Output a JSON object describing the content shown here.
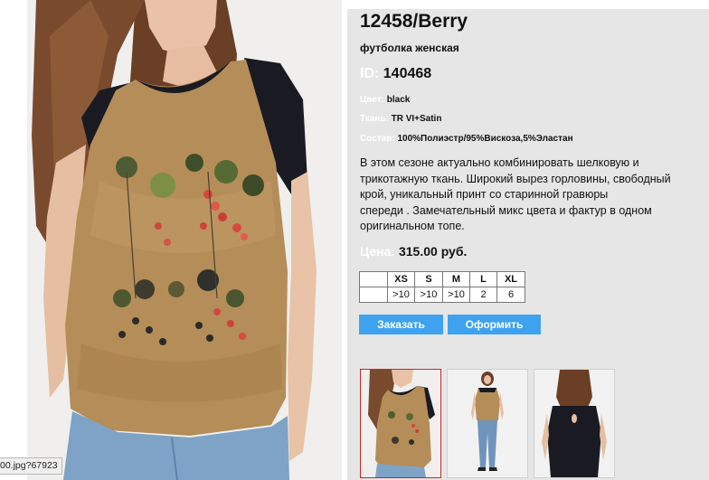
{
  "product": {
    "title": "12458/Berry",
    "subtitle": "футболка женская",
    "id_label": "ID:",
    "id_value": "140468",
    "color_label": "Цвет:",
    "color_value": "black",
    "fabric_label": "Ткань:",
    "fabric_value": "TR VI+Satin",
    "composition_label": "Состав:",
    "composition_value": "100%Полиэстр/95%Вискоза,5%Эластан",
    "description_lines": [
      "В этом сезоне актуально комбинировать шелковую и",
      "трикотажную ткань. Широкий вырез горловины, свободный",
      "крой, уникальный принт со старинной гравюры",
      "спереди .  Замечательный микс цвета и фактур в одном",
      "оригинальном топе."
    ],
    "price_label": "Цена:",
    "price_value": "315.00 руб."
  },
  "sizes": {
    "headers": [
      "",
      "XS",
      "S",
      "M",
      "L",
      "XL"
    ],
    "stock": [
      "",
      ">10",
      ">10",
      ">10",
      "2",
      "6"
    ]
  },
  "buttons": {
    "order": "Заказать",
    "checkout": "Оформить"
  },
  "status_tip": "00.jpg?67923",
  "icons": {
    "main_photo": "product-photo-front",
    "thumb1": "thumbnail-front-closeup",
    "thumb2": "thumbnail-full-body",
    "thumb3": "thumbnail-back-view"
  },
  "colors": {
    "panel_bg": "#e6e6e6",
    "button_bg": "#3fa2ee",
    "active_thumb_border": "#c62828",
    "shirt_gold": "#b58d58",
    "shirt_black": "#1a1a22"
  }
}
